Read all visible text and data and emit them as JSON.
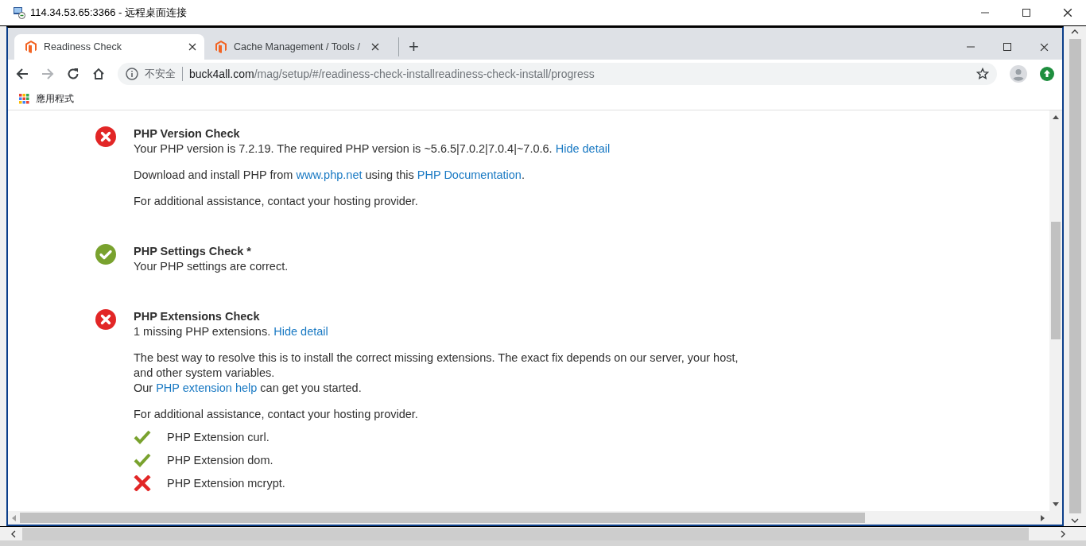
{
  "remote_window": {
    "title": "114.34.53.65:3366 - 远程桌面连接"
  },
  "browser": {
    "tabs": [
      {
        "title": "Readiness Check",
        "selected": true
      },
      {
        "title": "Cache Management / Tools /",
        "selected": false
      }
    ],
    "new_tab": "+",
    "address": {
      "security": "不安全",
      "host": "buck4all.com",
      "path": "/mag/setup/#/readiness-check-installreadiness-check-install/progress"
    },
    "bookmarks": [
      {
        "label": "應用程式"
      }
    ]
  },
  "checks": [
    {
      "title": "PHP Version Check",
      "passed": false,
      "summary": [
        {
          "kind": "text",
          "text": "Your PHP version is 7.2.19. The required PHP version is ~5.6.5|7.0.2|7.0.4|~7.0.6. "
        },
        {
          "kind": "link",
          "text": "Hide detail"
        }
      ],
      "details": [
        [
          [
            {
              "kind": "text",
              "text": "Download and install PHP from "
            },
            {
              "kind": "link",
              "text": "www.php.net"
            },
            {
              "kind": "text",
              "text": " using this "
            },
            {
              "kind": "link",
              "text": "PHP Documentation"
            },
            {
              "kind": "text",
              "text": "."
            }
          ]
        ],
        [
          [
            {
              "kind": "text",
              "text": "For additional assistance, contact your hosting provider."
            }
          ]
        ]
      ]
    },
    {
      "title": "PHP Settings Check *",
      "passed": true,
      "summary": [
        {
          "kind": "text",
          "text": "Your PHP settings are correct."
        }
      ]
    },
    {
      "title": "PHP Extensions Check",
      "passed": false,
      "summary": [
        {
          "kind": "text",
          "text": "1 missing PHP extensions. "
        },
        {
          "kind": "link",
          "text": "Hide detail"
        }
      ],
      "details": [
        [
          [
            {
              "kind": "text",
              "text": "The best way to resolve this is to install the correct missing extensions. The exact fix depends on our server, your host, and other system variables."
            }
          ],
          [
            {
              "kind": "text",
              "text": "Our "
            },
            {
              "kind": "link",
              "text": "PHP extension help"
            },
            {
              "kind": "text",
              "text": " can get you started."
            }
          ]
        ],
        [
          [
            {
              "kind": "text",
              "text": "For additional assistance, contact your hosting provider."
            }
          ]
        ]
      ],
      "extensions": [
        {
          "name": "PHP Extension curl.",
          "installed": true
        },
        {
          "name": "PHP Extension dom.",
          "installed": true
        },
        {
          "name": "PHP Extension mcrypt.",
          "installed": false
        }
      ]
    }
  ]
}
